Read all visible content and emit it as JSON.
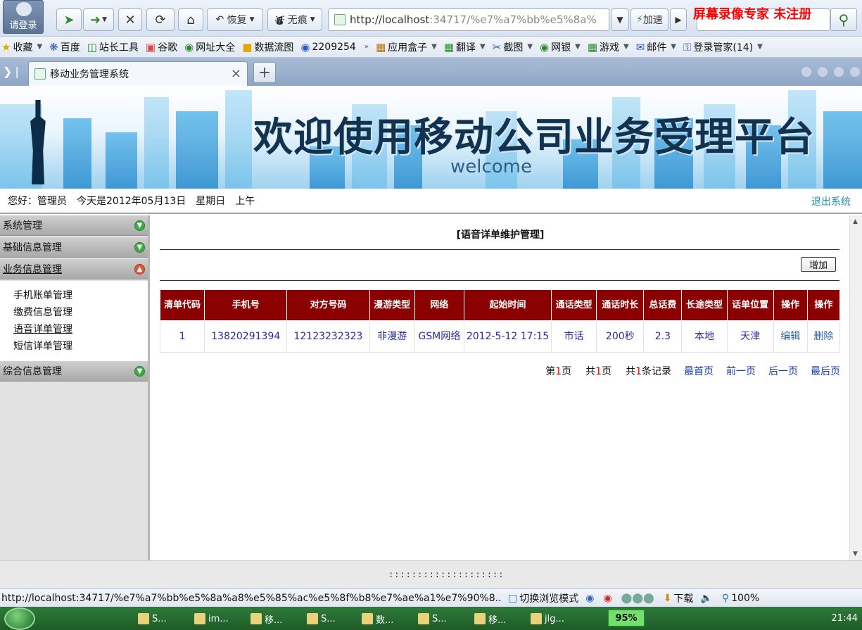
{
  "browser": {
    "login_label": "请登录",
    "restore_label": "恢复",
    "traceless_label": "无痕",
    "url_host": "http://localhost",
    "url_path": ":34717/%e7%a7%bb%e5%8a%",
    "accelerate_label": "加速",
    "watermark": "屏幕录像专家  未注册"
  },
  "favorites": [
    {
      "label": "收藏",
      "icon": "star-icon"
    },
    {
      "label": "百度",
      "icon": "paw-icon"
    },
    {
      "label": "站长工具",
      "icon": "page-icon"
    },
    {
      "label": "谷歌",
      "icon": "google-icon"
    },
    {
      "label": "网址大全",
      "icon": "globe-icon"
    },
    {
      "label": "数据流图",
      "icon": "folder-icon"
    },
    {
      "label": "2209254",
      "icon": "circle-icon"
    },
    {
      "label": "应用盒子",
      "icon": "box-icon"
    },
    {
      "label": "翻译",
      "icon": "translate-icon"
    },
    {
      "label": "截图",
      "icon": "scissors-icon"
    },
    {
      "label": "网银",
      "icon": "bank-icon"
    },
    {
      "label": "游戏",
      "icon": "game-icon"
    },
    {
      "label": "邮件",
      "icon": "mail-icon"
    },
    {
      "label": "登录管家(14)",
      "icon": "key-icon"
    }
  ],
  "tab": {
    "title": "移动业务管理系统"
  },
  "banner": {
    "title": "欢迎使用移动公司业务受理平台",
    "subtitle": "welcome"
  },
  "greeting": {
    "user": "您好：管理员",
    "date": "今天是2012年05月13日",
    "weekday": "星期日",
    "period": "上午",
    "logout": "退出系统"
  },
  "sidebar": {
    "sections": [
      {
        "label": "系统管理"
      },
      {
        "label": "基础信息管理"
      },
      {
        "label": "业务信息管理"
      },
      {
        "label": "综合信息管理"
      }
    ],
    "business_items": [
      {
        "label": "手机账单管理"
      },
      {
        "label": "缴费信息管理"
      },
      {
        "label": "语音详单管理"
      },
      {
        "label": "短信详单管理"
      }
    ]
  },
  "main": {
    "title": "[语音详单维护管理]",
    "add_label": "增加",
    "columns": [
      "清单代码",
      "手机号",
      "对方号码",
      "漫游类型",
      "网络",
      "起始时间",
      "通话类型",
      "通话时长",
      "总话费",
      "长途类型",
      "话单位置",
      "操作",
      "操作"
    ],
    "rows": [
      [
        "1",
        "13820291394",
        "12123232323",
        "非漫游",
        "GSM网络",
        "2012-5-12 17:15",
        "市话",
        "200秒",
        "2.3",
        "本地",
        "天津",
        "编辑",
        "删除"
      ]
    ],
    "pager": {
      "page_prefix": "第",
      "page_num": "1",
      "page_suffix": "页",
      "total_prefix": "共",
      "total_pages": "1",
      "total_suffix": "页",
      "rec_prefix": "共",
      "total_records": "1",
      "rec_suffix": "条记录",
      "first": "最首页",
      "prev": "前一页",
      "next": "后一页",
      "last": "最后页"
    }
  },
  "statusbar": {
    "url": "http://localhost:34717/%e7%a7%bb%e5%8a%a8%e5%85%ac%e5%8f%b8%e7%ae%a1%e7%90%8...",
    "switch_mode": "切换浏览模式",
    "download": "下载",
    "zoom": "100%"
  },
  "taskbar": {
    "tasks": [
      "S...",
      "im...",
      "移...",
      "S...",
      "数...",
      "S...",
      "移...",
      "jlg..."
    ],
    "battery": "95%",
    "clock": "21:44"
  }
}
